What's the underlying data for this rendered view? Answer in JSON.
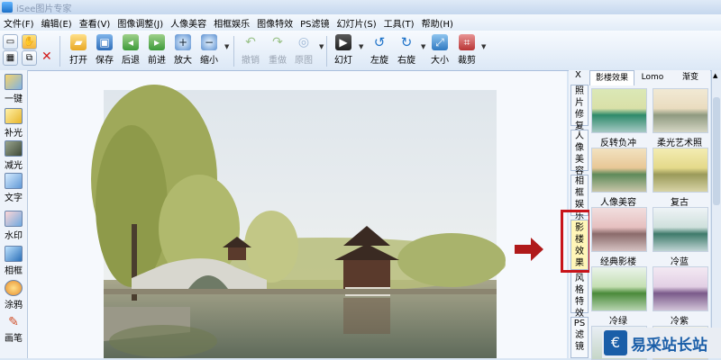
{
  "window": {
    "title": "iSee图片专家"
  },
  "menu": [
    "文件(F)",
    "编辑(E)",
    "查看(V)",
    "图像调整(J)",
    "人像美容",
    "相框娱乐",
    "图像特效",
    "PS滤镜",
    "幻灯片(S)",
    "工具(T)",
    "帮助(H)"
  ],
  "toolbar": {
    "open": "打开",
    "save": "保存",
    "back": "后退",
    "forward": "前进",
    "zoom_in": "放大",
    "zoom_out": "缩小",
    "undo": "撤销",
    "redo": "重做",
    "original": "原图",
    "slideshow": "幻灯",
    "rotate_left": "左旋",
    "rotate_right": "右旋",
    "resize": "大小",
    "crop": "裁剪"
  },
  "left_tools": [
    "一键",
    "补光",
    "减光",
    "文字",
    "水印",
    "相框",
    "涂鸦",
    "画笔"
  ],
  "right_panel": {
    "close": "X",
    "vtabs": [
      "照片修复",
      "人像美容",
      "相框娱乐",
      "影楼效果",
      "风格特效",
      "PS滤镜"
    ],
    "active_vtab": "影楼效果",
    "htabs": [
      "影楼效果",
      "Lomo",
      "渐变"
    ],
    "effects": [
      "反转负冲",
      "柔光艺术照",
      "人像美容",
      "复古",
      "经典影楼",
      "冷蓝",
      "冷绿",
      "冷紫"
    ]
  },
  "watermark": {
    "text": "易采站长站"
  },
  "colors": {
    "highlight_box": "#c8141a",
    "arrow": "#b01a1a",
    "active_tab": "#fff6b8"
  }
}
